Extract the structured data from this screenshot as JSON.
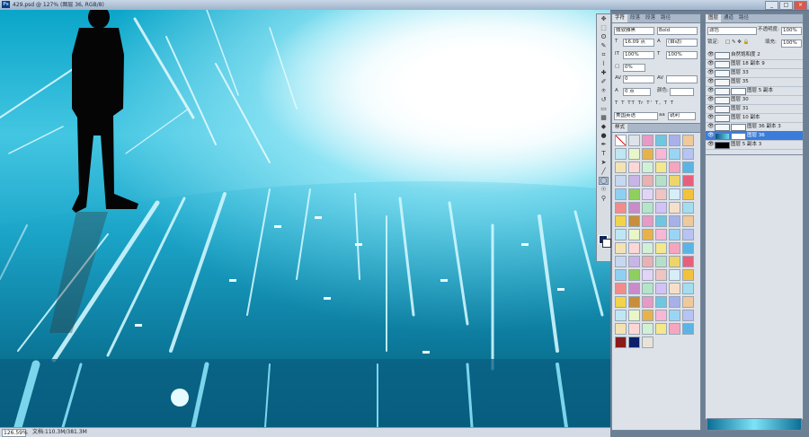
{
  "window": {
    "title": "429.psd @ 127% (图层 36, RGB/8)",
    "app_icon": "Ps",
    "minimize": "_",
    "maximize": "□",
    "close": "×"
  },
  "statusbar": {
    "zoom": "126.59%",
    "doc": "文档:110.3M/381.3M"
  },
  "character": {
    "tabs": [
      "字符",
      "段落",
      "段落",
      "路径"
    ],
    "font_family": "微软雅黑",
    "font_style": "Bold",
    "font_size": "16.09 点",
    "leading": "(自动)",
    "vscale": "100%",
    "hscale": "100%",
    "tracking": "0%",
    "kerning": "0",
    "baseline": "0 点",
    "color_label": "颜色:",
    "style_buttons": [
      "T",
      "T",
      "TT",
      "Tr",
      "T'",
      "T,",
      "T",
      "T"
    ],
    "language": "美国英语",
    "antialias": "锐利"
  },
  "styles": {
    "tab": "样式"
  },
  "layers": {
    "tabs": [
      "图层",
      "通道",
      "路径"
    ],
    "blend_mode": "滤色",
    "opacity_label": "不透明度:",
    "opacity": "100%",
    "lock_label": "锁定:",
    "fill_label": "填充:",
    "fill": "100%",
    "items": [
      {
        "name": "自然饱和度 2",
        "selected": false
      },
      {
        "name": "图层 18 副本 9",
        "selected": false
      },
      {
        "name": "图层 33",
        "selected": false
      },
      {
        "name": "图层 35",
        "selected": false
      },
      {
        "name": "图层 5 副本",
        "selected": false
      },
      {
        "name": "图层 30",
        "selected": false
      },
      {
        "name": "图层 31",
        "selected": false
      },
      {
        "name": "图层 10 副本",
        "selected": false
      },
      {
        "name": "图层 36 副本 3",
        "selected": false
      },
      {
        "name": "图层 36",
        "selected": true
      },
      {
        "name": "图层 5 副本 3",
        "selected": false
      }
    ]
  },
  "colors": {
    "accent": "#3b7bd9",
    "foreground": "#0b2760",
    "background": "#ffffff"
  }
}
